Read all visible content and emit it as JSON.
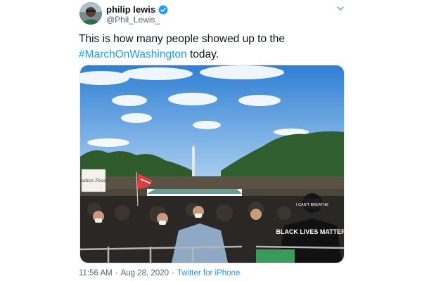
{
  "author": {
    "display_name": "philip lewis",
    "handle": "@Phil_Lewis_",
    "verified": true
  },
  "tweet": {
    "text_before": "This is how many people showed up to the",
    "hashtag": "#MarchOnWashington",
    "text_after": " today."
  },
  "photo": {
    "sign_text": "Justice Peace",
    "shirt_text": "BLACK LIVES MATTER",
    "mask_text": "I CAN'T BREATHE"
  },
  "meta": {
    "time": "11:56 AM",
    "separator": "·",
    "date": "Aug 28, 2020",
    "source": "Twitter for iPhone"
  },
  "colors": {
    "link": "#1d9bf0",
    "verified": "#1d9bf0",
    "secondary_text": "#536471"
  },
  "icons": [
    "verified-badge-icon",
    "chevron-down-icon"
  ]
}
